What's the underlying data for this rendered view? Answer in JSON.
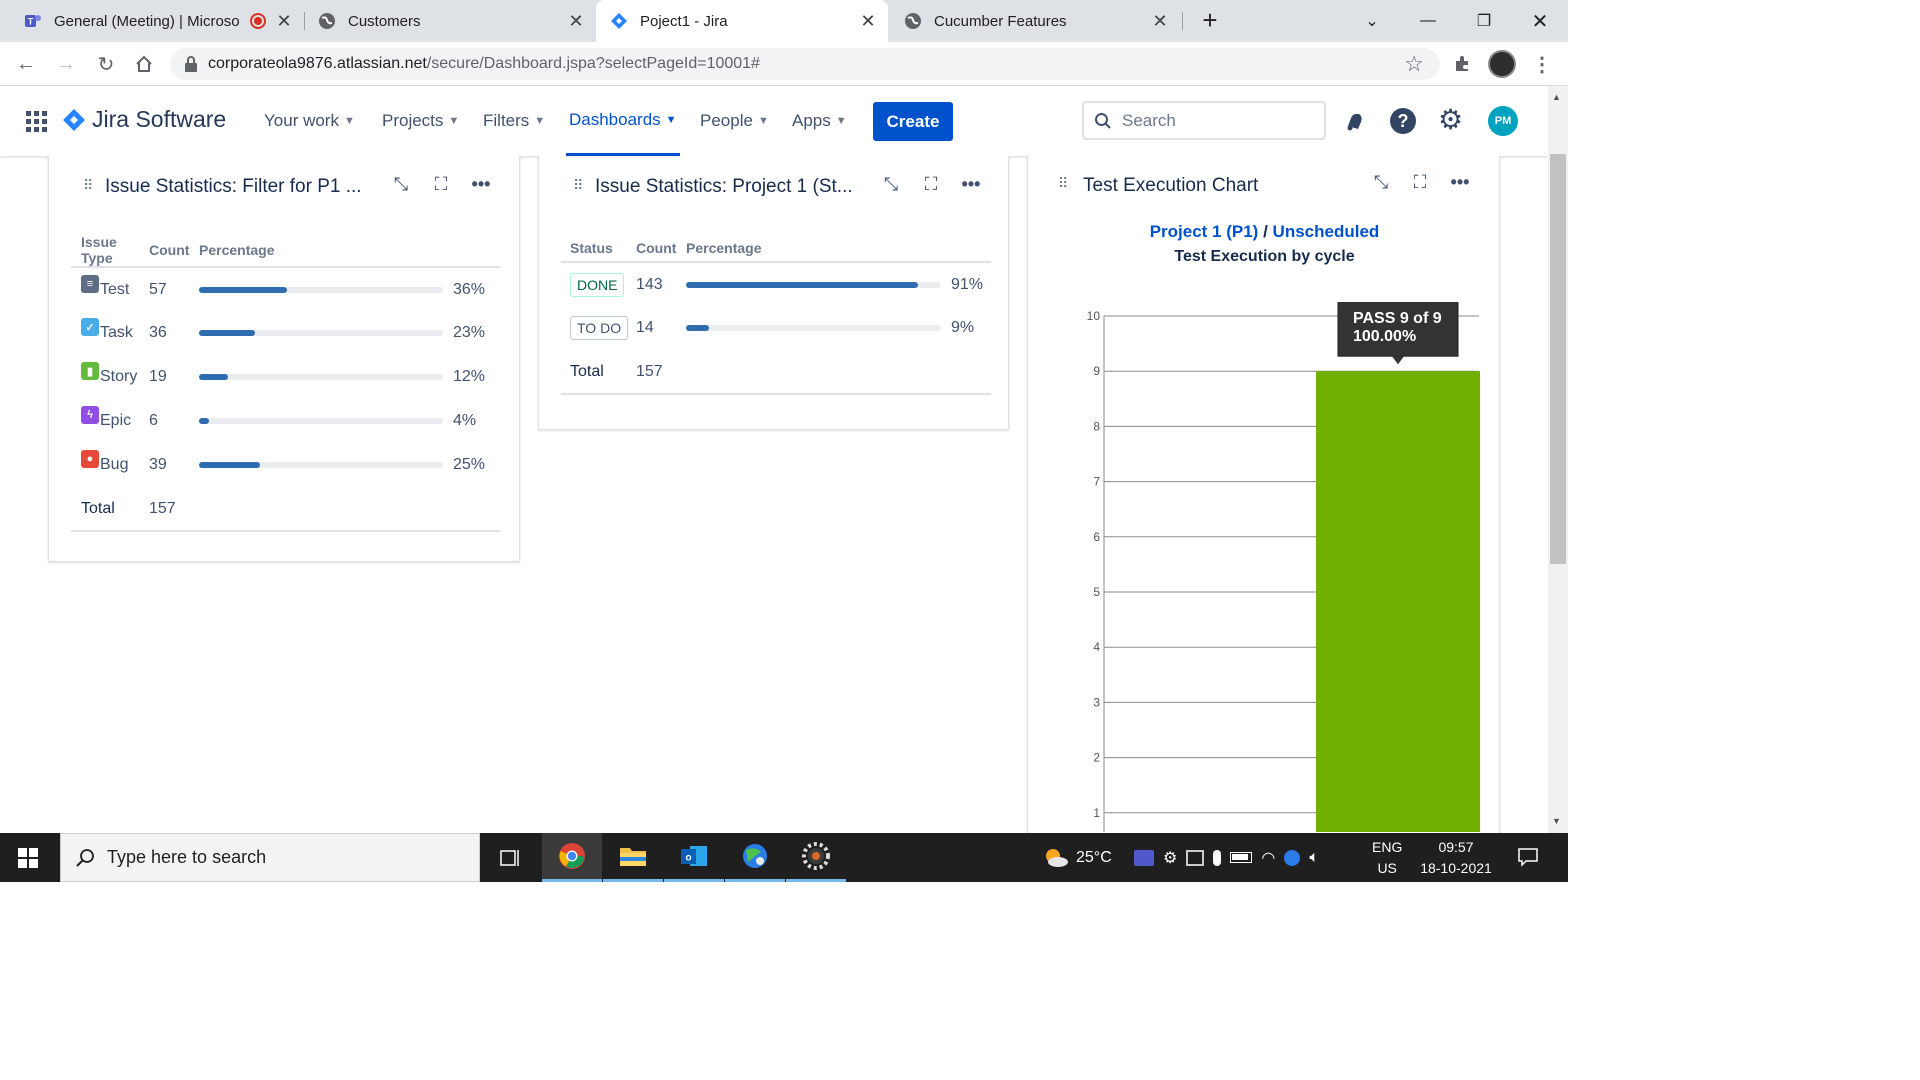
{
  "browser": {
    "tabs": [
      {
        "title": "General (Meeting) | Microsof",
        "favicon": "teams-icon",
        "recording": true
      },
      {
        "title": "Customers",
        "favicon": "globe-icon"
      },
      {
        "title": "Poject1 - Jira",
        "favicon": "jira-icon",
        "active": true
      },
      {
        "title": "Cucumber Features",
        "favicon": "globe-icon"
      }
    ],
    "new_tab_label": "+",
    "url_host": "corporateola9876.atlassian.net",
    "url_path": "/secure/Dashboard.jspa?selectPageId=10001#"
  },
  "jira": {
    "product_name": "Jira Software",
    "nav": [
      {
        "label": "Your work"
      },
      {
        "label": "Projects"
      },
      {
        "label": "Filters"
      },
      {
        "label": "Dashboards",
        "active": true
      },
      {
        "label": "People"
      },
      {
        "label": "Apps"
      }
    ],
    "create_label": "Create",
    "search_placeholder": "Search",
    "avatar_initials": "PM",
    "accent_color": "#0052cc"
  },
  "gadgets": {
    "issue_type_stats": {
      "title": "Issue Statistics: Filter for P1 ...",
      "columns": [
        "Issue Type",
        "Count",
        "Percentage"
      ],
      "rows": [
        {
          "type": "Test",
          "icon": "test-icon",
          "color": "#5e6c84",
          "count": "57",
          "percent": "36%",
          "fraction": 0.36
        },
        {
          "type": "Task",
          "icon": "task-icon",
          "color": "#4bade8",
          "count": "36",
          "percent": "23%",
          "fraction": 0.23
        },
        {
          "type": "Story",
          "icon": "story-icon",
          "color": "#63ba3c",
          "count": "19",
          "percent": "12%",
          "fraction": 0.12
        },
        {
          "type": "Epic",
          "icon": "epic-icon",
          "color": "#904ee2",
          "count": "6",
          "percent": "4%",
          "fraction": 0.04
        },
        {
          "type": "Bug",
          "icon": "bug-icon",
          "color": "#e5493a",
          "count": "39",
          "percent": "25%",
          "fraction": 0.25
        }
      ],
      "total_label": "Total",
      "total": "157"
    },
    "status_stats": {
      "title": "Issue Statistics: Project 1 (St...",
      "columns": [
        "Status",
        "Count",
        "Percentage"
      ],
      "rows": [
        {
          "status": "DONE",
          "count": "143",
          "percent": "91%",
          "fraction": 0.91
        },
        {
          "status": "TO DO",
          "count": "14",
          "percent": "9%",
          "fraction": 0.09
        }
      ],
      "total_label": "Total",
      "total": "157"
    },
    "test_execution": {
      "title": "Test Execution Chart",
      "project_link": "Project 1 (P1)",
      "separator": "/",
      "cycle_link": "Unscheduled",
      "subtitle": "Test Execution by cycle",
      "tooltip_line1": "PASS 9 of 9",
      "tooltip_line2": "100.00%"
    }
  },
  "chart_data": {
    "type": "bar",
    "title": "Test Execution by cycle",
    "categories": [
      "Unscheduled"
    ],
    "series": [
      {
        "name": "PASS",
        "values": [
          9
        ],
        "color": "#6fb000"
      }
    ],
    "yticks": [
      1,
      2,
      3,
      4,
      5,
      6,
      7,
      8,
      9,
      10
    ],
    "ylim": [
      0,
      10
    ],
    "grid": true
  },
  "taskbar": {
    "search_placeholder": "Type here to search",
    "weather": "25°C",
    "lang_line1": "ENG",
    "lang_line2": "US",
    "time": "09:57",
    "date": "18-10-2021"
  }
}
